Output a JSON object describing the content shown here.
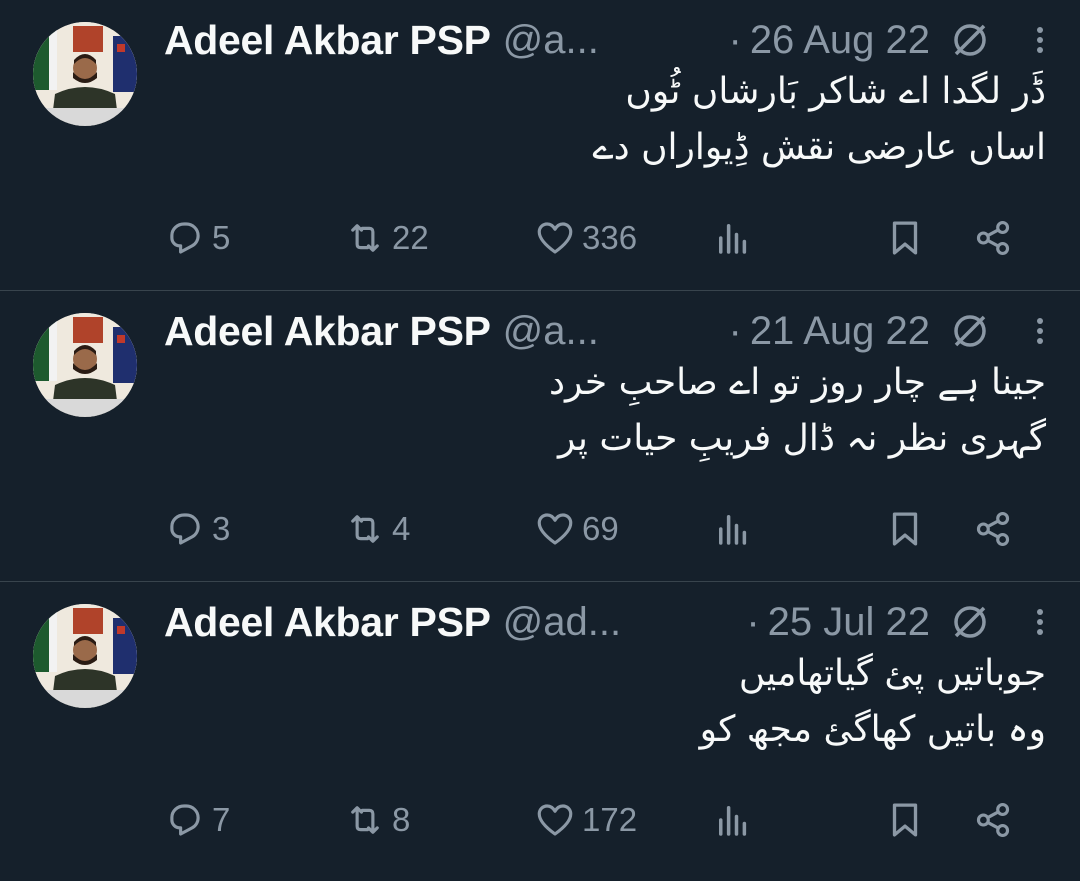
{
  "tweets": [
    {
      "author_name": "Adeel Akbar PSP",
      "handle": "@a...",
      "dot": "·",
      "date": "26 Aug 22",
      "lines": [
        "ڈَر لگدا اے شاکر بَارشاں ٹُوں",
        "اساں عارضی نقش ڈِیواراں دے"
      ],
      "replies": "5",
      "retweets": "22",
      "likes": "336"
    },
    {
      "author_name": "Adeel Akbar PSP",
      "handle": "@a...",
      "dot": "·",
      "date": "21 Aug 22",
      "lines": [
        "جینا ہے چار روز تو اے صاحبِ خرد",
        "گہری نظر نہ ڈال فریبِ حیات پر"
      ],
      "replies": "3",
      "retweets": "4",
      "likes": "69"
    },
    {
      "author_name": "Adeel Akbar PSP",
      "handle": "@ad...",
      "dot": "·",
      "date": "25 Jul 22",
      "lines": [
        "جوباتیں پئ گیاتھامیں",
        "وہ باتیں کھاگئ مجھ کو"
      ],
      "replies": "7",
      "retweets": "8",
      "likes": "172"
    }
  ],
  "icons": {
    "reply": "reply-icon",
    "retweet": "retweet-icon",
    "like": "heart-icon",
    "views": "views-icon",
    "bookmark": "bookmark-icon",
    "share": "share-icon",
    "more": "more-icon",
    "verified": "unverified-icon"
  },
  "colors": {
    "background": "#15202b",
    "text": "#f7f9f9",
    "secondary": "#8b98a5",
    "divider": "#38444d"
  }
}
